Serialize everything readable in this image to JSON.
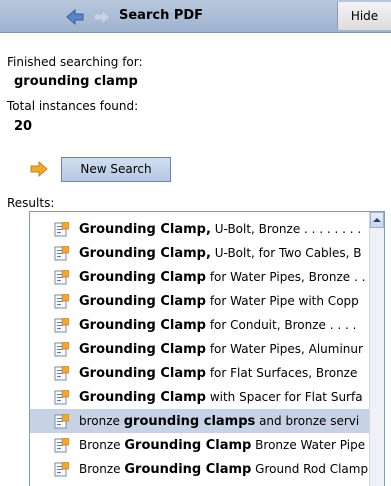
{
  "toolbar": {
    "title": "Search PDF",
    "hide_label": "Hide",
    "back_icon": "back-arrow-icon",
    "forward_icon": "forward-arrow-icon"
  },
  "status": {
    "finished_label": "Finished searching for:",
    "query": "grounding clamp",
    "total_label": "Total instances found:",
    "count": "20"
  },
  "actions": {
    "new_search_label": "New Search",
    "arrow_icon": "orange-arrow-icon"
  },
  "results": {
    "label": "Results:",
    "items": [
      {
        "bold": "Grounding Clamp,",
        "rest": " U-Bolt, Bronze . . . . . . . .",
        "selected": false
      },
      {
        "bold": "Grounding Clamp,",
        "rest": " U-Bolt, for Two Cables, B",
        "selected": false
      },
      {
        "bold": "Grounding Clamp",
        "rest": " for Water Pipes, Bronze . .",
        "selected": false
      },
      {
        "bold": "Grounding Clamp",
        "rest": " for Water Pipe with Copp",
        "selected": false
      },
      {
        "bold": "Grounding Clamp",
        "rest": " for Conduit, Bronze . . . .",
        "selected": false
      },
      {
        "bold": "Grounding Clamp",
        "rest": " for Water Pipes, Aluminur",
        "selected": false
      },
      {
        "bold": "Grounding Clamp",
        "rest": " for Flat Surfaces, Bronze",
        "selected": false
      },
      {
        "bold": "Grounding Clamp",
        "rest": " with Spacer for Flat Surfa",
        "selected": false
      },
      {
        "pre": "bronze ",
        "bold": "grounding clamps",
        "rest": " and bronze servi",
        "selected": true
      },
      {
        "pre": "Bronze ",
        "bold": "Grounding Clamp",
        "rest": " Bronze Water Pipe",
        "selected": false
      },
      {
        "pre": "Bronze ",
        "bold": "Grounding Clamp",
        "rest": " Ground Rod Clamp",
        "selected": false
      }
    ]
  },
  "colors": {
    "accent_orange": "#f0a830",
    "selection": "#c7d2e4",
    "toolbar": "#a9bcd7"
  }
}
